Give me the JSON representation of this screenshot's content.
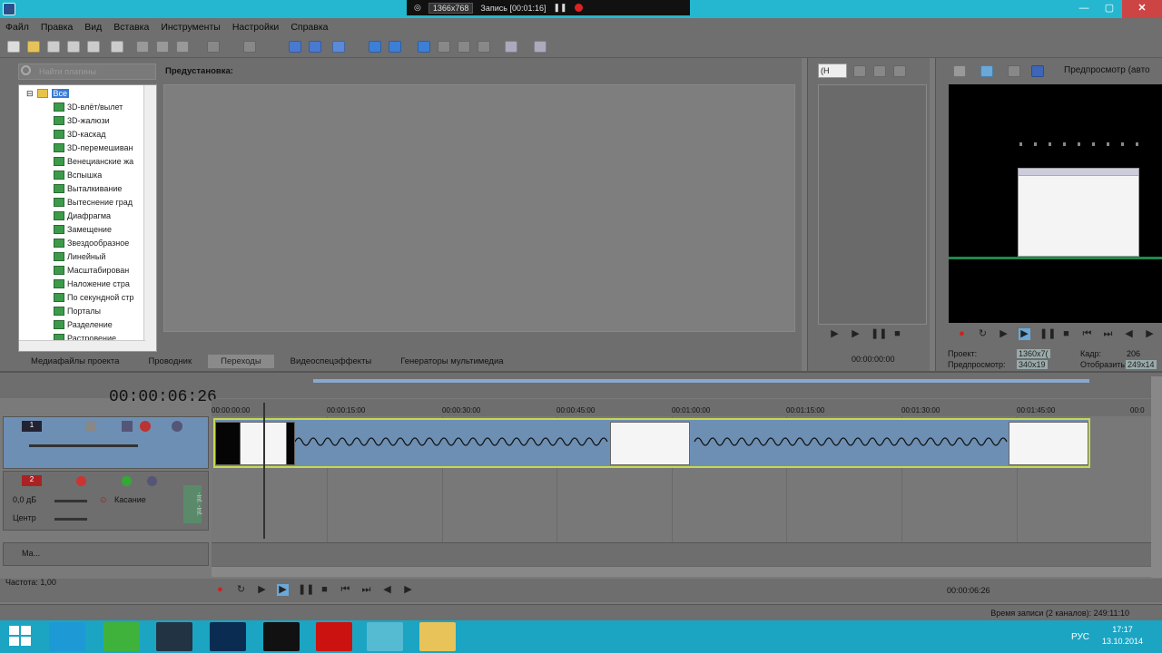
{
  "recorder": {
    "resolution": "1366x768",
    "status": "Запись [00:01:16]"
  },
  "window": {
    "minimize": "—",
    "maximize": "▢",
    "close": "✕"
  },
  "menu": [
    "Файл",
    "Правка",
    "Вид",
    "Вставка",
    "Инструменты",
    "Настройки",
    "Справка"
  ],
  "explorer": {
    "search_placeholder": "Найти плагины",
    "root": "Все",
    "items": [
      "3D-влёт/вылет",
      "3D-жалюзи",
      "3D-каскад",
      "3D-перемешиван",
      "Венецианские жа",
      "Вспышка",
      "Выталкивание",
      "Вытеснение град",
      "Диафрагма",
      "Замещение",
      "Звездообразное",
      "Линейный",
      "Масштабирован",
      "Наложение стра",
      "По секундной стр",
      "Порталы",
      "Разделение",
      "Растровение"
    ],
    "preset_label": "Предустановка:",
    "tabs": [
      "Медиафайлы проекта",
      "Проводник",
      "Переходы",
      "Видеоспецэффекты",
      "Генераторы мультимедиа"
    ],
    "active_tab": "Переходы"
  },
  "trimmer": {
    "select": "(Н",
    "time": "00:00:00:00"
  },
  "preview": {
    "title": "Предпросмотр (авто",
    "project_label": "Проект:",
    "project_value": "1360x7(",
    "preview_label": "Предпросмотр:",
    "preview_value": "340x19",
    "frame_label": "Кадр:",
    "frame_value": "206",
    "display_label": "Отобразить:",
    "display_value": "249x14"
  },
  "timeline": {
    "current_time": "00:00:06:26",
    "ruler": [
      "00:00:00:00",
      "00:00:15:00",
      "00:00:30:00",
      "00:00:45:00",
      "00:01:00:00",
      "00:01:15:00",
      "00:01:30:00",
      "00:01:45:00",
      "00:0"
    ],
    "video_track": {
      "number": "1"
    },
    "audio_track": {
      "number": "2",
      "volume": "0,0 дБ",
      "mode": "Касание",
      "pan": "Центр",
      "level_label": "-Inf. -Inf."
    },
    "master_track": {
      "label": "Ма..."
    },
    "rate": "Частота: 1,00",
    "transport_time": "00:00:06:26",
    "record_time": "Время записи (2 каналов): 249:11:10"
  },
  "taskbar": {
    "apps": [
      "windows-start",
      "skype",
      "camtasia-green",
      "cinema4d",
      "photoshop",
      "wordpad-w",
      "record-red",
      "vegas",
      "explorer-folder"
    ],
    "language": "РУС",
    "time": "17:17",
    "date": "13.10.2014"
  },
  "colors": {
    "accent": "#25b7cf",
    "track_video": "#6d8fb4",
    "clip_border": "#c6d850"
  }
}
